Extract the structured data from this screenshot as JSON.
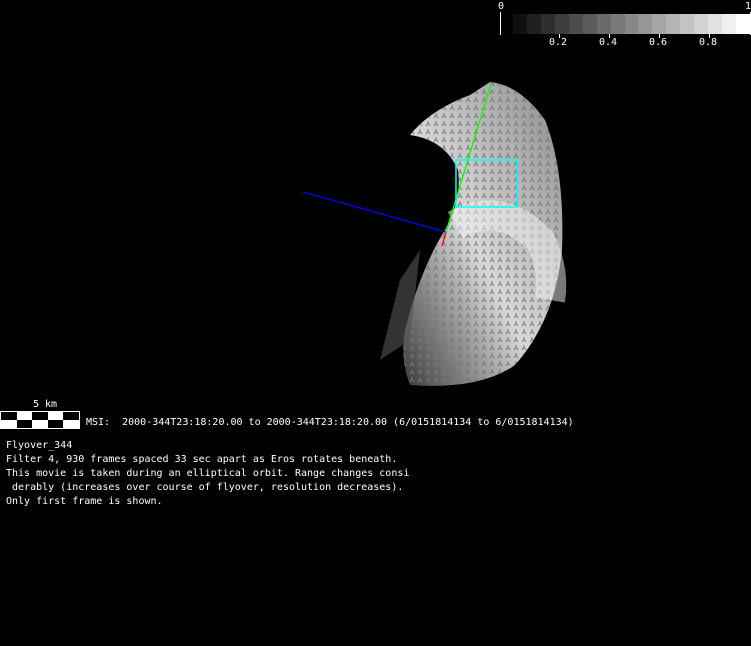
{
  "colorbar": {
    "min_label": "0",
    "max_label": "1",
    "tick_labels": [
      "0.2",
      "0.4",
      "0.6",
      "0.8"
    ],
    "steps": 17
  },
  "scale": {
    "label": "5 km"
  },
  "msi_line": "MSI:  2000-344T23:18:20.00 to 2000-344T23:18:20.00 (6/0151814134 to 6/0151814134)",
  "description": {
    "title": "Flyover_344",
    "lines": [
      "Filter 4, 930 frames spaced 33 sec apart as Eros rotates beneath.",
      "This movie is taken during an elliptical orbit. Range changes consi",
      " derably (increases over course of flyover, resolution decreases).",
      "Only first frame is shown."
    ]
  },
  "colors": {
    "x_axis": "#ff0000",
    "y_axis": "#00ff00",
    "z_axis": "#0000ff",
    "footprint": "#00ffff"
  }
}
